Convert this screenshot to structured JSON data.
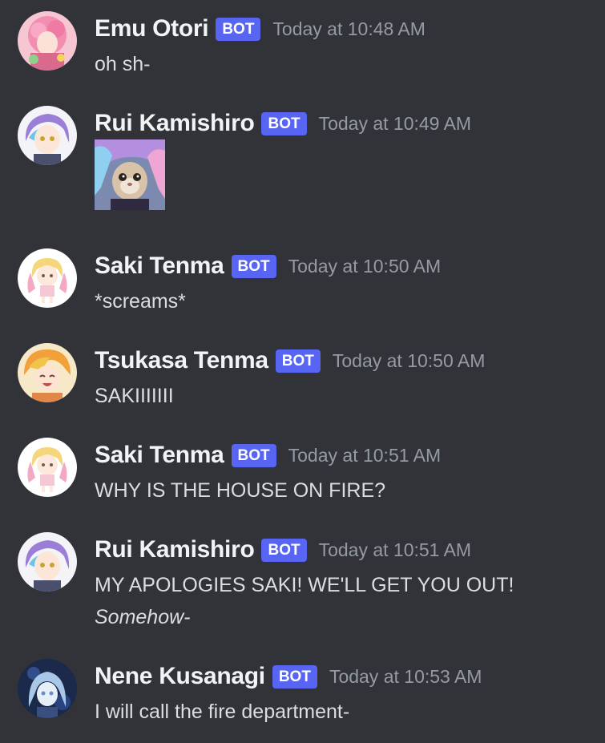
{
  "messages": [
    {
      "username": "Emu Otori",
      "badge": "BOT",
      "timestamp": "Today at 10:48 AM",
      "text": "oh sh-"
    },
    {
      "username": "Rui Kamishiro",
      "badge": "BOT",
      "timestamp": "Today at 10:49 AM",
      "attachment": "cat-with-wig-image"
    },
    {
      "username": "Saki Tenma",
      "badge": "BOT",
      "timestamp": "Today at 10:50 AM",
      "text": "*screams*"
    },
    {
      "username": "Tsukasa Tenma",
      "badge": "BOT",
      "timestamp": "Today at 10:50 AM",
      "text": "SAKIIIIIII"
    },
    {
      "username": "Saki Tenma",
      "badge": "BOT",
      "timestamp": "Today at 10:51 AM",
      "text": "WHY IS THE HOUSE ON FIRE?"
    },
    {
      "username": "Rui Kamishiro",
      "badge": "BOT",
      "timestamp": "Today at 10:51 AM",
      "text": "MY APOLOGIES SAKI! WE'LL GET YOU OUT!",
      "text_italic": "Somehow-"
    },
    {
      "username": "Nene Kusanagi",
      "badge": "BOT",
      "timestamp": "Today at 10:53 AM",
      "text": "I will call the fire department-"
    }
  ],
  "colors": {
    "background": "#313338",
    "username": "#f2f3f5",
    "badge": "#5865f2",
    "timestamp": "#949ba4",
    "message_text": "#dbdee1"
  }
}
